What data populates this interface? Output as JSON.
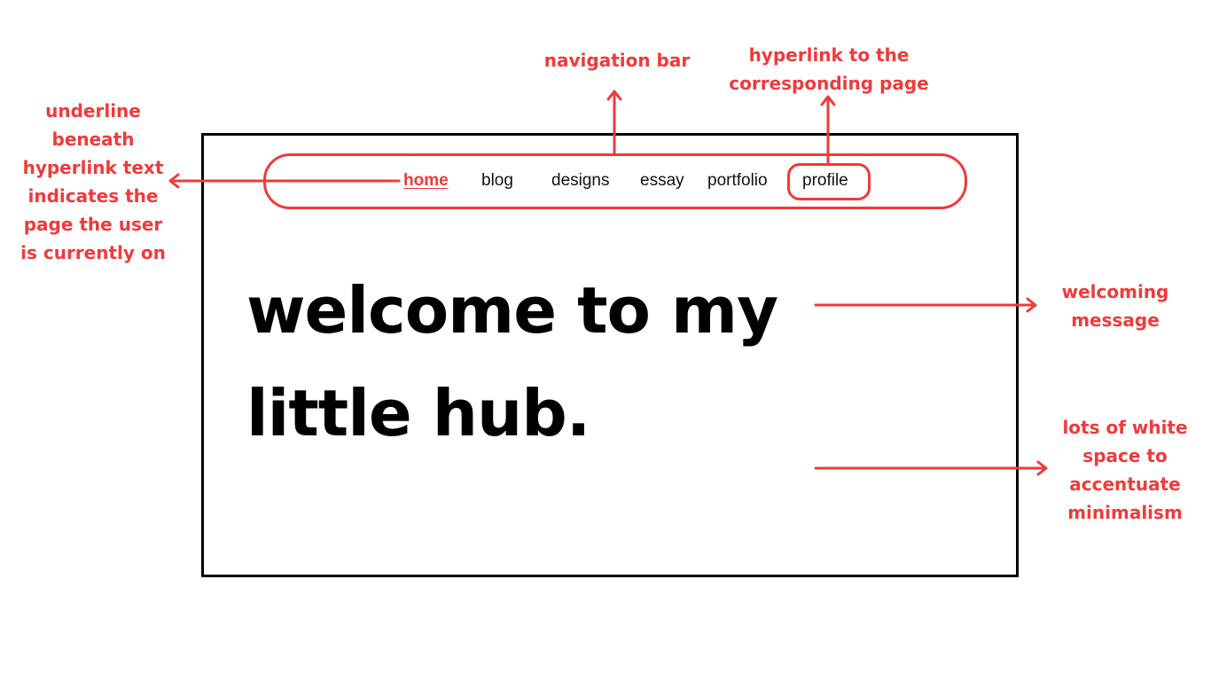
{
  "nav": {
    "items": [
      {
        "label": "home",
        "active": true
      },
      {
        "label": "blog",
        "active": false
      },
      {
        "label": "designs",
        "active": false
      },
      {
        "label": "essay",
        "active": false
      },
      {
        "label": "portfolio",
        "active": false
      },
      {
        "label": "profile",
        "active": false
      }
    ]
  },
  "main": {
    "welcome_line1": "welcome to my",
    "welcome_line2": "little hub."
  },
  "annotations": {
    "navigation_bar": "navigation bar",
    "hyperlink_line1": "hyperlink to the",
    "hyperlink_line2": "corresponding page",
    "underline_lines": [
      "underline",
      "beneath",
      "hyperlink text",
      "indicates the",
      "page the user",
      "is currently on"
    ],
    "welcoming_lines": [
      "welcoming",
      "message"
    ],
    "whitespace_lines": [
      "lots of white",
      "space to",
      "accentuate",
      "minimalism"
    ]
  },
  "colors": {
    "accent": "#f03a3a",
    "frame": "#000000",
    "text": "#111111",
    "background": "#ffffff"
  }
}
